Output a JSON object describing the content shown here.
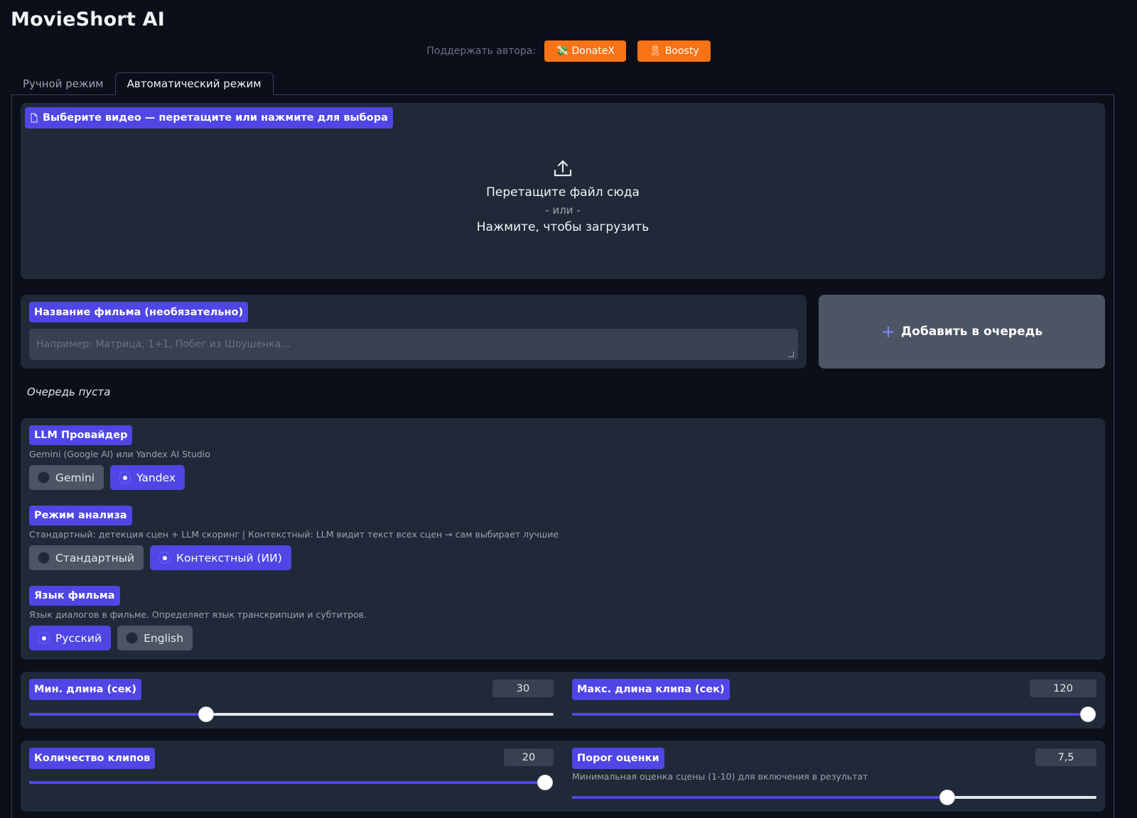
{
  "app": {
    "title": "MovieShort AI"
  },
  "support": {
    "label": "Поддержать автора:",
    "buttons": [
      {
        "label": "DonateX",
        "icon": "money-wings-icon",
        "color": "#f97316"
      },
      {
        "label": "Boosty",
        "icon": "ribbon-icon",
        "color": "#f97316"
      }
    ]
  },
  "tabs": [
    {
      "label": "Ручной режим",
      "active": false
    },
    {
      "label": "Автоматический режим",
      "active": true
    }
  ],
  "upload": {
    "label": "Выберите видео — перетащите или нажмите для выбора",
    "drop_text": "Перетащите файл сюда",
    "or_text": "- или -",
    "click_text": "Нажмите, чтобы загрузить"
  },
  "movie_title": {
    "label": "Название фильма (необязательно)",
    "placeholder": "Например: Матрица, 1+1, Побег из Шоушенка...",
    "value": ""
  },
  "queue": {
    "add_label": "Добавить в очередь",
    "empty_text": "Очередь пуста"
  },
  "llm_provider": {
    "label": "LLM Провайдер",
    "info": "Gemini (Google AI) или Yandex AI Studio",
    "options": [
      "Gemini",
      "Yandex"
    ],
    "selected": "Yandex"
  },
  "analysis_mode": {
    "label": "Режим анализа",
    "info": "Стандартный: детекция сцен + LLM скоринг | Контекстный: LLM видит текст всех сцен → сам выбирает лучшие",
    "options": [
      "Стандартный",
      "Контекстный (ИИ)"
    ],
    "selected": "Контекстный (ИИ)"
  },
  "film_language": {
    "label": "Язык фильма",
    "info": "Язык диалогов в фильме. Определяет язык транскрипции и субтитров.",
    "options": [
      "Русский",
      "English"
    ],
    "selected": "Русский"
  },
  "sliders": {
    "min_length": {
      "label": "Мин. длина (сек)",
      "value": "30",
      "fraction": 0.338
    },
    "max_length": {
      "label": "Макс. длина клипа (сек)",
      "value": "120",
      "fraction": 1.0
    },
    "clip_count": {
      "label": "Количество клипов",
      "value": "20",
      "fraction": 1.0
    },
    "score_threshold": {
      "label": "Порог оценки",
      "value": "7,5",
      "info": "Минимальная оценка сцены (1-10) для включения в результат",
      "fraction": 0.715
    }
  },
  "colors": {
    "accent": "#4f46e5",
    "background": "#0b0f19",
    "panel": "#1f2937",
    "donate": "#f97316"
  }
}
